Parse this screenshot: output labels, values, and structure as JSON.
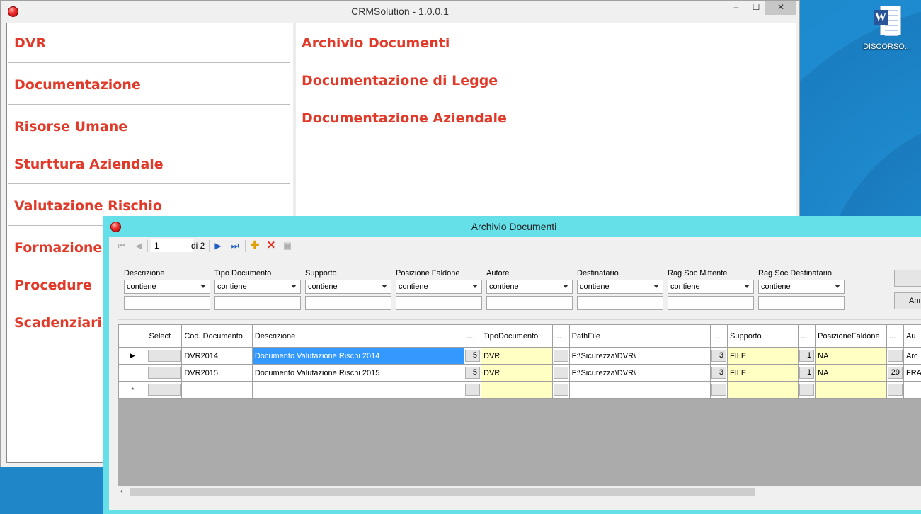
{
  "desktop": {
    "icon_label": "DISCORSO...",
    "icon_name": "word-document-icon"
  },
  "main_window": {
    "title": "CRMSolution - 1.0.0.1",
    "controls": {
      "minimize": "‒",
      "maximize": "☐",
      "close": "✕"
    },
    "menu": [
      "DVR",
      "Documentazione",
      "Risorse Umane",
      "Sturttura Aziendale",
      "Valutazione Rischio",
      "Formazione",
      "Procedure",
      "Scadenziario"
    ],
    "links": [
      "Archivio Documenti",
      "Documentazione di Legge",
      "Documentazione Aziendale"
    ],
    "accent_color": "#e03b2a"
  },
  "child_window": {
    "title": "Archivio Documenti",
    "title_bg": "#65dfe8",
    "navigator": {
      "position": "1",
      "count_text": "di 2"
    },
    "filters": [
      {
        "label": "Descrizione",
        "operator": "contiene",
        "value": ""
      },
      {
        "label": "Tipo Documento",
        "operator": "contiene",
        "value": ""
      },
      {
        "label": "Supporto",
        "operator": "contiene",
        "value": ""
      },
      {
        "label": "Posizione Faldone",
        "operator": "contiene",
        "value": ""
      },
      {
        "label": "Autore",
        "operator": "contiene",
        "value": ""
      },
      {
        "label": "Destinatario",
        "operator": "contiene",
        "value": ""
      },
      {
        "label": "Rag Soc Mittente",
        "operator": "contiene",
        "value": ""
      },
      {
        "label": "Rag Soc Destinatario",
        "operator": "contiene",
        "value": ""
      }
    ],
    "side_buttons": [
      "",
      "Ann"
    ],
    "grid": {
      "columns": [
        "",
        "Select",
        "Cod. Documento",
        "Descrizione",
        "...",
        "TipoDocumento",
        "...",
        "PathFile",
        "...",
        "Supporto",
        "...",
        "PosizioneFaldone",
        "...",
        "Au"
      ],
      "rows": [
        {
          "marker": "▶",
          "cod": "DVR2014",
          "descrizione": "Documento Valutazione Rischi 2014",
          "tipo_id": "5",
          "tipo": "DVR",
          "path": "F:\\Sicurezza\\DVR\\",
          "supporto_id": "3",
          "supporto": "FILE",
          "pos_id": "1",
          "posizione": "NA",
          "autore_id": "",
          "autore": "Arc"
        },
        {
          "marker": "",
          "cod": "DVR2015",
          "descrizione": "Documento Valutazione Rischi 2015",
          "tipo_id": "5",
          "tipo": "DVR",
          "path": "F:\\Sicurezza\\DVR\\",
          "supporto_id": "3",
          "supporto": "FILE",
          "pos_id": "1",
          "posizione": "NA",
          "autore_id": "29",
          "autore": "FRA"
        },
        {
          "marker": "*",
          "cod": "",
          "descrizione": "",
          "tipo_id": "",
          "tipo": "",
          "path": "",
          "supporto_id": "",
          "supporto": "",
          "pos_id": "",
          "posizione": "",
          "autore_id": "",
          "autore": ""
        }
      ]
    }
  }
}
